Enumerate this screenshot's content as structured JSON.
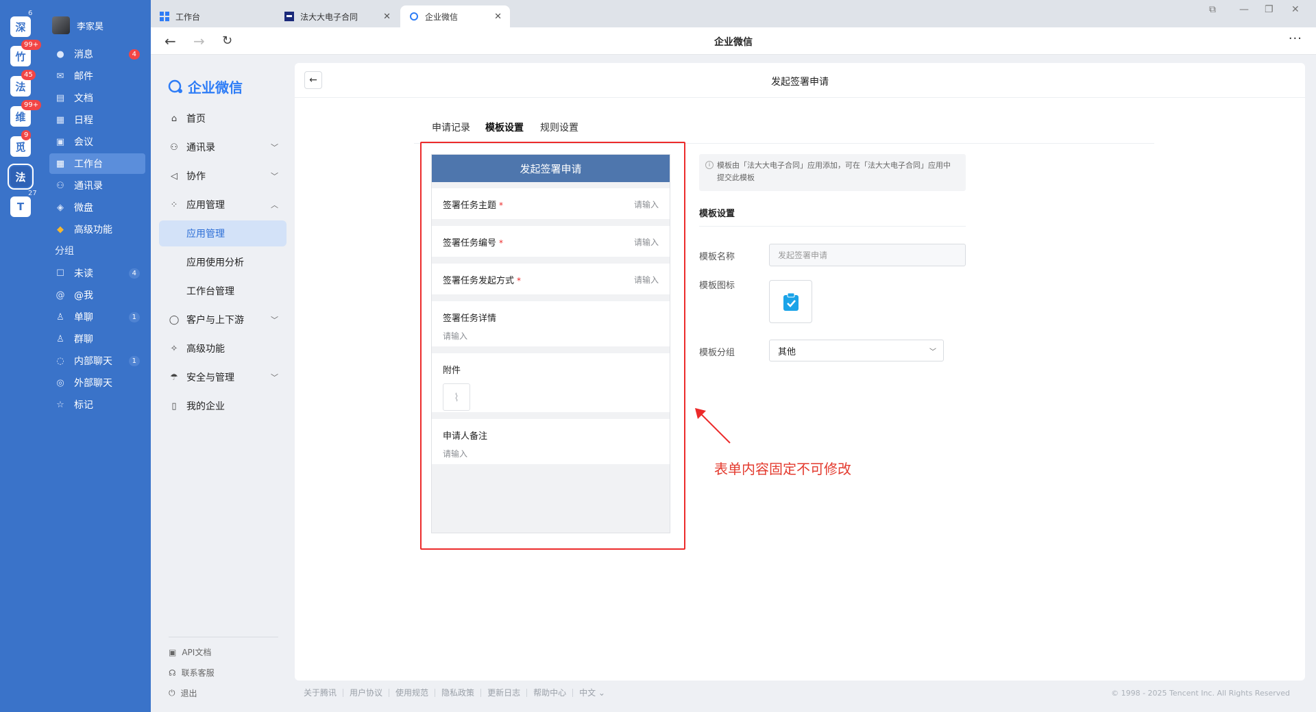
{
  "rail": {
    "apps": [
      {
        "label": "深",
        "badge": "6"
      },
      {
        "label": "竹",
        "badge": "99+"
      },
      {
        "label": "法",
        "badge": "45"
      },
      {
        "label": "维",
        "badge": "99+"
      },
      {
        "label": "觅",
        "badge": "9"
      },
      {
        "label": "法",
        "badge": ""
      },
      {
        "label": "T",
        "badge": "27"
      }
    ]
  },
  "messenger": {
    "user_name": "李家昊",
    "items": [
      {
        "label": "消息",
        "count": "4",
        "icon": "chat-icon"
      },
      {
        "label": "邮件",
        "count": "",
        "icon": "mail-icon"
      },
      {
        "label": "文档",
        "count": "",
        "icon": "doc-icon"
      },
      {
        "label": "日程",
        "count": "",
        "icon": "calendar-icon"
      },
      {
        "label": "会议",
        "count": "",
        "icon": "meeting-icon"
      },
      {
        "label": "工作台",
        "count": "",
        "icon": "grid-icon"
      },
      {
        "label": "通讯录",
        "count": "",
        "icon": "contacts-icon"
      },
      {
        "label": "微盘",
        "count": "",
        "icon": "drive-icon"
      },
      {
        "label": "高级功能",
        "count": "",
        "icon": "advanced-icon"
      }
    ],
    "group_title": "分组",
    "groups": [
      {
        "label": "未读",
        "count": "4",
        "icon": "unread-icon"
      },
      {
        "label": "@我",
        "count": "",
        "icon": "at-icon"
      },
      {
        "label": "单聊",
        "count": "1",
        "icon": "person-icon"
      },
      {
        "label": "群聊",
        "count": "",
        "icon": "group-icon"
      },
      {
        "label": "内部聊天",
        "count": "1",
        "icon": "bubble-icon"
      },
      {
        "label": "外部聊天",
        "count": "",
        "icon": "external-icon"
      },
      {
        "label": "标记",
        "count": "",
        "icon": "star-icon"
      }
    ]
  },
  "browser": {
    "tabs": [
      {
        "label": "工作台"
      },
      {
        "label": "法大大电子合同"
      },
      {
        "label": "企业微信"
      }
    ],
    "page_caption": "企业微信",
    "more": "···"
  },
  "sidebar": {
    "logo_text": "企业微信",
    "items": [
      {
        "label": "首页"
      },
      {
        "label": "通讯录"
      },
      {
        "label": "协作"
      },
      {
        "label": "应用管理"
      },
      {
        "label": "客户与上下游"
      },
      {
        "label": "高级功能"
      },
      {
        "label": "安全与管理"
      },
      {
        "label": "我的企业"
      }
    ],
    "sub_items": [
      {
        "label": "应用管理"
      },
      {
        "label": "应用使用分析"
      },
      {
        "label": "工作台管理"
      }
    ],
    "footer": [
      {
        "label": "API文档"
      },
      {
        "label": "联系客服"
      },
      {
        "label": "退出"
      }
    ]
  },
  "main": {
    "title": "发起签署申请",
    "subtabs": [
      "申请记录",
      "模板设置",
      "规则设置"
    ],
    "preview": {
      "header": "发起签署申请",
      "fields": [
        {
          "label": "签署任务主题",
          "placeholder": "请输入"
        },
        {
          "label": "签署任务编号",
          "placeholder": "请输入"
        },
        {
          "label": "签署任务发起方式",
          "placeholder": "请输入"
        },
        {
          "label": "签署任务详情",
          "placeholder": "请输入"
        },
        {
          "label": "附件"
        },
        {
          "label": "申请人备注",
          "placeholder": "请输入"
        }
      ]
    },
    "annotation": "表单内容固定不可修改",
    "info_text": "模板由「法大大电子合同」应用添加，可在「法大大电子合同」应用中提交此模板",
    "section_title": "模板设置",
    "template_name_label": "模板名称",
    "template_name_placeholder": "发起签署申请",
    "template_icon_label": "模板图标",
    "template_group_label": "模板分组",
    "template_group_value": "其他"
  },
  "footer": {
    "links": [
      "关于腾讯",
      "用户协议",
      "使用规范",
      "隐私政策",
      "更新日志",
      "帮助中心",
      "中文 ⌄"
    ],
    "copyright": "© 1998 - 2025 Tencent Inc. All Rights Reserved"
  },
  "colors": {
    "rail_blue": "#3a73c9",
    "accent": "#2d7cf6",
    "preview_header": "#4e76ad",
    "annotation_red": "#ec2a2a"
  }
}
